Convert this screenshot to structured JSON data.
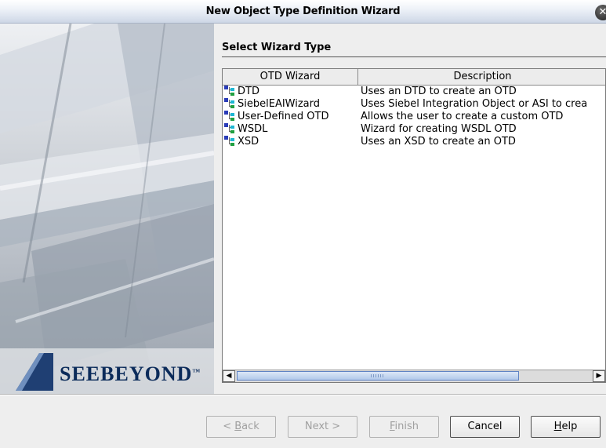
{
  "window": {
    "title": "New Object Type Definition Wizard",
    "close_glyph": "✕"
  },
  "brand": {
    "logo_text": "SEEBEYOND",
    "tm": "™"
  },
  "page": {
    "section_title": "Select Wizard Type"
  },
  "table": {
    "columns": [
      "OTD Wizard",
      "Description"
    ],
    "rows": [
      {
        "name": "DTD",
        "description": "Uses an DTD to create an OTD"
      },
      {
        "name": "SiebelEAIWizard",
        "description": "Uses Siebel Integration Object or ASI to crea"
      },
      {
        "name": "User-Defined OTD",
        "description": "Allows the user to create a custom OTD"
      },
      {
        "name": "WSDL",
        "description": "Wizard for creating WSDL OTD"
      },
      {
        "name": "XSD",
        "description": "Uses an XSD to create an OTD"
      }
    ],
    "row_icon": "otd-tree-icon",
    "scroll_left_glyph": "◀",
    "scroll_right_glyph": "▶"
  },
  "buttons": {
    "back": {
      "pre": "< ",
      "mn": "B",
      "post": "ack",
      "enabled": false
    },
    "next": {
      "label": "Next >",
      "enabled": false
    },
    "finish": {
      "mn": "F",
      "post": "inish",
      "enabled": false
    },
    "cancel": {
      "label": "Cancel",
      "enabled": true
    },
    "help": {
      "mn": "H",
      "post": "elp",
      "enabled": true
    }
  },
  "colors": {
    "title_bar": "#eef2f8",
    "thumb": "#b2c8ea",
    "background": "#eeeeee"
  }
}
